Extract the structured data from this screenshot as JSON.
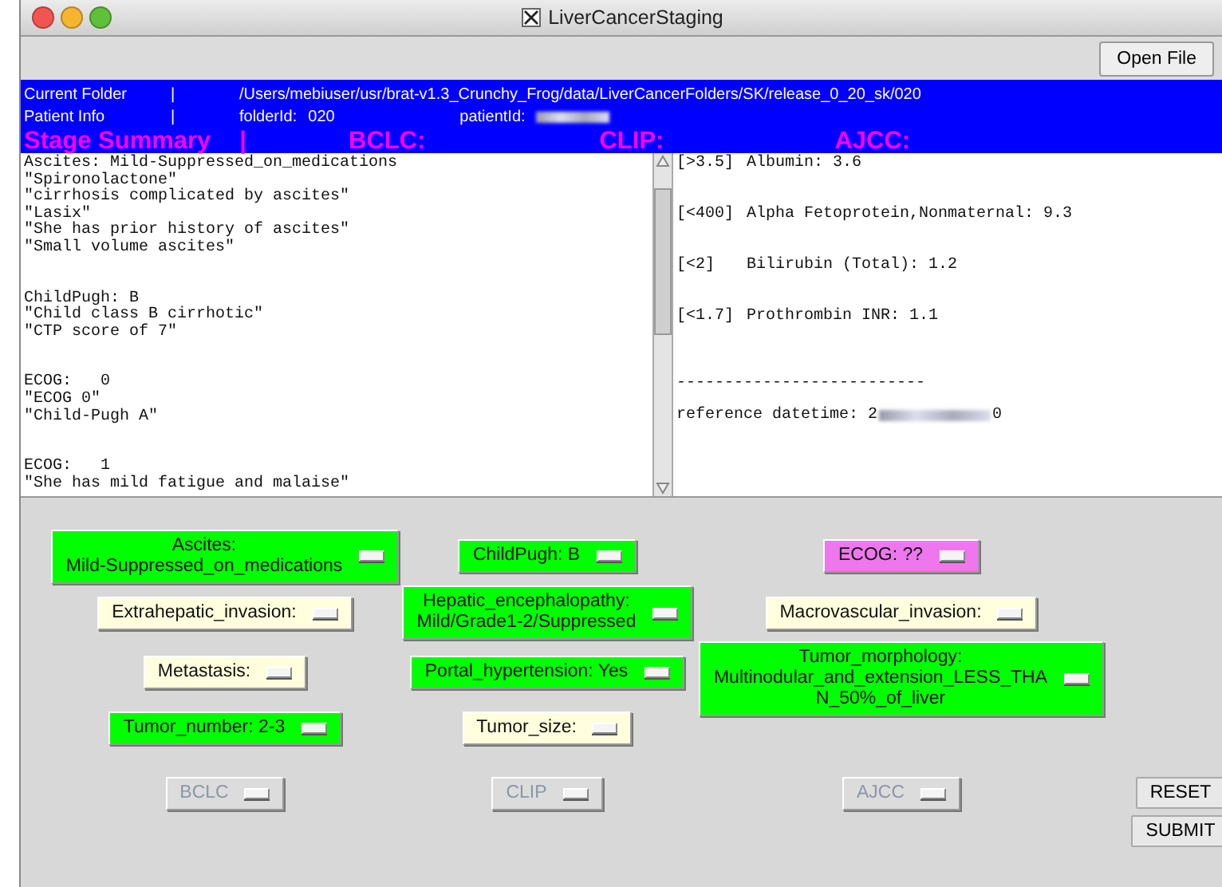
{
  "window": {
    "title": "LiverCancerStaging",
    "toolbar": {
      "open_button": "Open File"
    }
  },
  "info": {
    "folder_label": "Current Folder",
    "folder_sep": "|",
    "folder_path": "/Users/mebiuser/usr/brat-v1.3_Crunchy_Frog/data/LiverCancerFolders/SK/release_0_20_sk/020",
    "patient_label": "Patient Info",
    "patient_sep": "|",
    "folder_id_label": "folderId:",
    "folder_id": "020",
    "patient_id_label": "patientId:",
    "summary": [
      "Stage Summary",
      "|",
      "BCLC:",
      "CLIP:",
      "AJCC:"
    ]
  },
  "evidence": {
    "groups": [
      {
        "lines": [
          "Ascites: Mild-Suppressed_on_medications",
          "\"Spironolactone\"",
          "\"cirrhosis complicated by ascites\"",
          "\"Lasix\"",
          "\"She has prior history of ascites\"",
          "\"Small volume ascites\""
        ]
      },
      {
        "lines": [
          "ChildPugh: B",
          "\"Child class B cirrhotic\"",
          "\"CTP score of 7\""
        ]
      },
      {
        "lines": [
          "ECOG:   0",
          "\"ECOG 0\"",
          "\"Child-Pugh A\""
        ]
      },
      {
        "lines": [
          "ECOG:   1",
          "\"She has mild fatigue and malaise\""
        ]
      }
    ]
  },
  "labs": {
    "rows": [
      {
        "range": "[>3.5]",
        "text": "Albumin: 3.6"
      },
      {
        "range": "[<400]",
        "text": "Alpha Fetoprotein,Nonmaternal: 9.3"
      },
      {
        "range": "[<2]",
        "text": "Bilirubin (Total): 1.2"
      },
      {
        "range": "[<1.7]",
        "text": "Prothrombin INR: 1.1"
      }
    ],
    "divider": "--------------------------",
    "reference_label": "reference datetime:",
    "reference_start": "2",
    "reference_end": "0"
  },
  "criteria": {
    "columns": [
      [
        {
          "lines": [
            "Ascites:",
            "Mild-Suppressed_on_medications"
          ],
          "color": "#00ff00"
        },
        {
          "lines": [
            "Extrahepatic_invasion:"
          ],
          "color": "#ffffdd"
        },
        {
          "lines": [
            "Metastasis:"
          ],
          "color": "#ffffdd"
        },
        {
          "lines": [
            "Tumor_number: 2-3"
          ],
          "color": "#00ff00"
        }
      ],
      [
        {
          "lines": [
            "ChildPugh: B"
          ],
          "color": "#00ff00"
        },
        {
          "lines": [
            "Hepatic_encephalopathy:",
            "Mild/Grade1-2/Suppressed"
          ],
          "color": "#00ff00"
        },
        {
          "lines": [
            "Portal_hypertension: Yes"
          ],
          "color": "#00ff00"
        },
        {
          "lines": [
            "Tumor_size:"
          ],
          "color": "#ffffdd"
        }
      ],
      [
        {
          "lines": [
            "ECOG: ??"
          ],
          "color": "#ee77ee"
        },
        {
          "lines": [
            "Macrovascular_invasion:"
          ],
          "color": "#ffffdd"
        },
        {
          "lines": [
            "Tumor_morphology:",
            "Multinodular_and_extension_LESS_THA",
            "N_50%_of_liver"
          ],
          "color": "#00ff00"
        }
      ]
    ]
  },
  "scores": [
    {
      "label": "BCLC",
      "disabled": true
    },
    {
      "label": "CLIP",
      "disabled": true
    },
    {
      "label": "AJCC",
      "disabled": true
    }
  ],
  "actions": [
    "RESET",
    "SUBMIT"
  ]
}
